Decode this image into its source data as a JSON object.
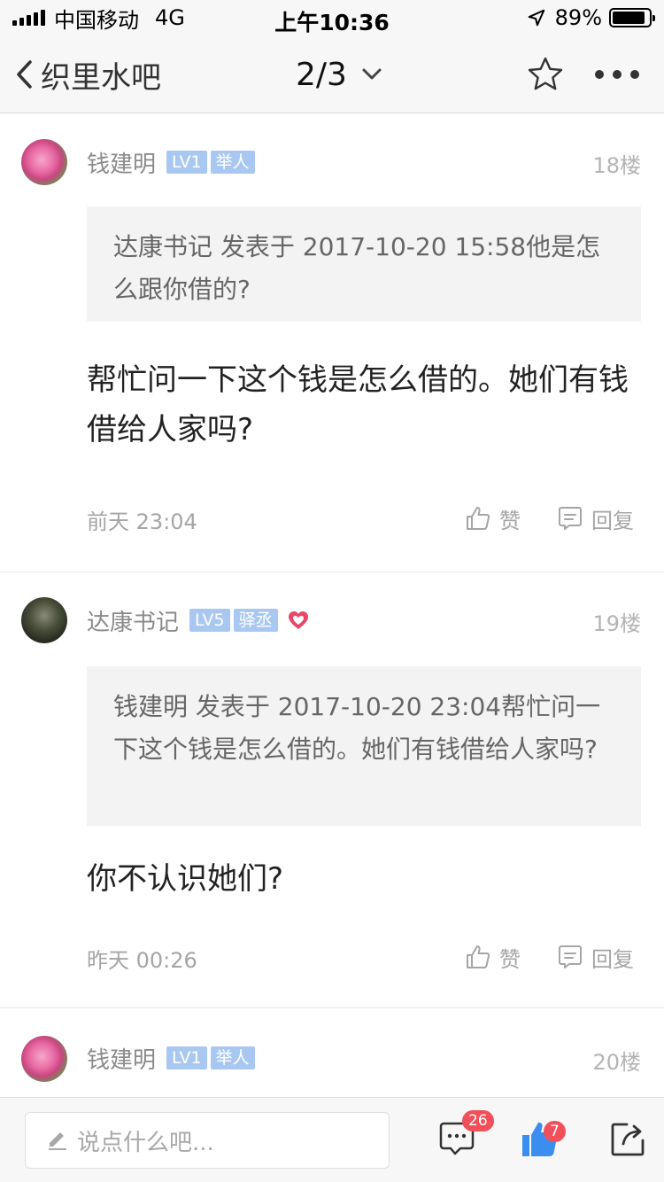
{
  "status_bar": {
    "carrier": "中国移动",
    "network": "4G",
    "time": "上午10:36",
    "battery_percent": "89%",
    "battery_level": 0.89
  },
  "nav": {
    "back_label": "织里水吧",
    "page_indicator": "2/3"
  },
  "posts": [
    {
      "username": "钱建明",
      "level": "LV1",
      "role": "举人",
      "floor": "18楼",
      "quote": "达康书记 发表于 2017-10-20 15:58他是怎么跟你借的?",
      "content": "帮忙问一下这个钱是怎么借的。她们有钱借给人家吗?",
      "time": "前天 23:04",
      "like_label": "赞",
      "reply_label": "回复"
    },
    {
      "username": "达康书记",
      "level": "LV5",
      "role": "驿丞",
      "floor": "19楼",
      "quote": "钱建明 发表于 2017-10-20 23:04帮忙问一下这个钱是怎么借的。她们有钱借给人家吗?",
      "content": "你不认识她们?",
      "time": "昨天 00:26",
      "like_label": "赞",
      "reply_label": "回复"
    },
    {
      "username": "钱建明",
      "level": "LV1",
      "role": "举人",
      "floor": "20楼"
    }
  ],
  "bottom_bar": {
    "input_placeholder": "说点什么吧...",
    "comment_count": "26",
    "like_count": "7"
  },
  "colors": {
    "tag_blue": "#a9c8f1",
    "badge_red": "#f1505a",
    "like_blue": "#3b8df0",
    "heart_red": "#e8476a"
  }
}
